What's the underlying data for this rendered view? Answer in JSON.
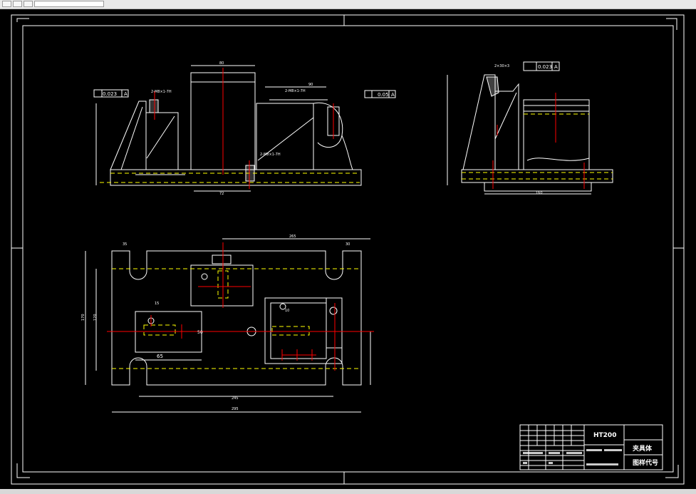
{
  "window": {
    "toolbar_icons": [
      "new-icon",
      "open-icon",
      "save-icon"
    ]
  },
  "drawing": {
    "material": "HT200",
    "part_name": "夹具体",
    "drawing_code": "图样代号",
    "tolerance_1": "0.023",
    "tolerance_2": "0.05",
    "tolerance_3": "0.023",
    "datum": "A",
    "dims": {
      "d245": "245",
      "d265": "265",
      "d295": "295",
      "d170": "170",
      "d120": "120",
      "d160": "160",
      "d65": "65",
      "d72": "72",
      "d50": "50",
      "d80": "80",
      "d90": "90",
      "d35": "35",
      "d30": "30",
      "d15": "15",
      "d10": "10"
    },
    "notes": {
      "thread_1": "2-M8×1-7H",
      "thread_2": "2-M8×1-7H",
      "thread_3": "2-M8×1-7H",
      "thread_4": "2×30×3"
    }
  },
  "colors": {
    "background": "#000000",
    "line": "#ffffff",
    "center": "#ff0000",
    "hidden": "#ffff00"
  }
}
